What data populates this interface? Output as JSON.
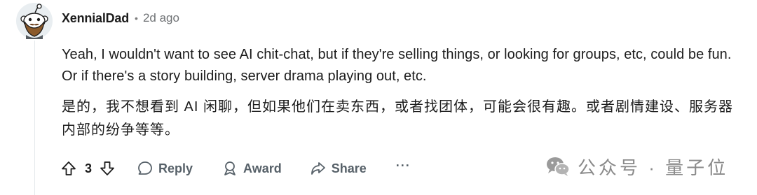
{
  "comment": {
    "author": "XennialDad",
    "separator": "•",
    "age": "2d ago",
    "body_en": "Yeah, I wouldn't want to see AI chit-chat, but if they're selling things, or looking for groups, etc, could be fun. Or if there's a story building, server drama playing out, etc.",
    "body_zh": "是的，我不想看到 AI 闲聊，但如果他们在卖东西，或者找团体，可能会很有趣。或者剧情建设、服务器内部的纷争等等。",
    "votes": "3"
  },
  "actions": {
    "reply_label": "Reply",
    "award_label": "Award",
    "share_label": "Share",
    "more_label": "···"
  },
  "watermark": {
    "text": "公众号 · 量子位"
  },
  "colors": {
    "text": "#1c1c1c",
    "meta": "#6f7275",
    "action": "#576169",
    "thread_line": "#e5e9ec",
    "avatar_bg": "#e9eef1"
  }
}
